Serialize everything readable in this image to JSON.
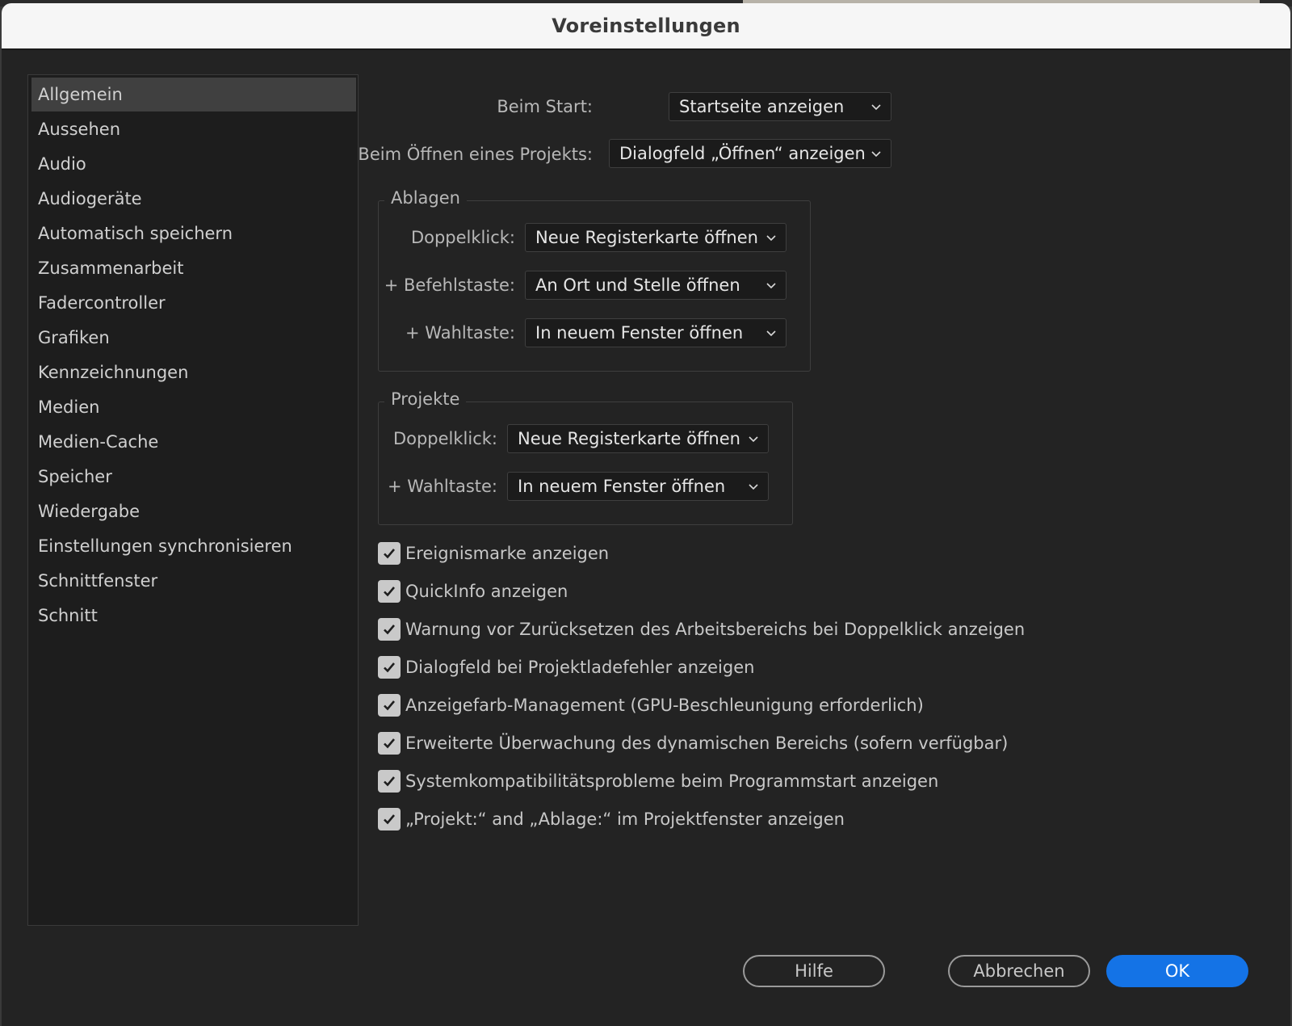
{
  "window": {
    "title": "Voreinstellungen"
  },
  "sidebar": {
    "items": [
      {
        "label": "Allgemein",
        "selected": true
      },
      {
        "label": "Aussehen"
      },
      {
        "label": "Audio"
      },
      {
        "label": "Audiogeräte"
      },
      {
        "label": "Automatisch speichern"
      },
      {
        "label": "Zusammenarbeit"
      },
      {
        "label": "Fadercontroller"
      },
      {
        "label": "Grafiken"
      },
      {
        "label": "Kennzeichnungen"
      },
      {
        "label": "Medien"
      },
      {
        "label": "Medien-Cache"
      },
      {
        "label": "Speicher"
      },
      {
        "label": "Wiedergabe"
      },
      {
        "label": "Einstellungen synchronisieren"
      },
      {
        "label": "Schnittfenster"
      },
      {
        "label": "Schnitt"
      }
    ]
  },
  "general": {
    "on_start": {
      "label": "Beim Start:",
      "value": "Startseite anzeigen"
    },
    "on_open_project": {
      "label": "Beim Öffnen eines Projekts:",
      "value": "Dialogfeld „Öffnen“ anzeigen"
    }
  },
  "bins": {
    "legend": "Ablagen",
    "double_click": {
      "label": "Doppelklick:",
      "value": "Neue Registerkarte öffnen"
    },
    "cmd": {
      "label": "+ Befehlstaste:",
      "value": "An Ort und Stelle öffnen"
    },
    "opt": {
      "label": "+ Wahltaste:",
      "value": "In neuem Fenster öffnen"
    }
  },
  "projects": {
    "legend": "Projekte",
    "double_click": {
      "label": "Doppelklick:",
      "value": "Neue Registerkarte öffnen"
    },
    "opt": {
      "label": "+ Wahltaste:",
      "value": "In neuem Fenster öffnen"
    }
  },
  "checkboxes": [
    {
      "label": "Ereignismarke anzeigen",
      "checked": true
    },
    {
      "label": "QuickInfo anzeigen",
      "checked": true
    },
    {
      "label": "Warnung vor Zurücksetzen des Arbeitsbereichs bei Doppelklick anzeigen",
      "checked": true
    },
    {
      "label": "Dialogfeld bei Projektladefehler anzeigen",
      "checked": true
    },
    {
      "label": "Anzeigefarb-Management (GPU-Beschleunigung erforderlich)",
      "checked": true
    },
    {
      "label": "Erweiterte Überwachung des dynamischen Bereichs (sofern verfügbar)",
      "checked": true
    },
    {
      "label": "Systemkompatibilitätsprobleme beim Programmstart anzeigen",
      "checked": true
    },
    {
      "label": "„Projekt:“ and „Ablage:“ im Projektfenster anzeigen",
      "checked": true
    }
  ],
  "buttons": {
    "help": "Hilfe",
    "cancel": "Abbrechen",
    "ok": "OK"
  },
  "colors": {
    "accent": "#1473e6",
    "background": "#232323",
    "sidebar": "#1d1d1d",
    "selected": "#404040",
    "checkbox": "#c9c9c9"
  }
}
